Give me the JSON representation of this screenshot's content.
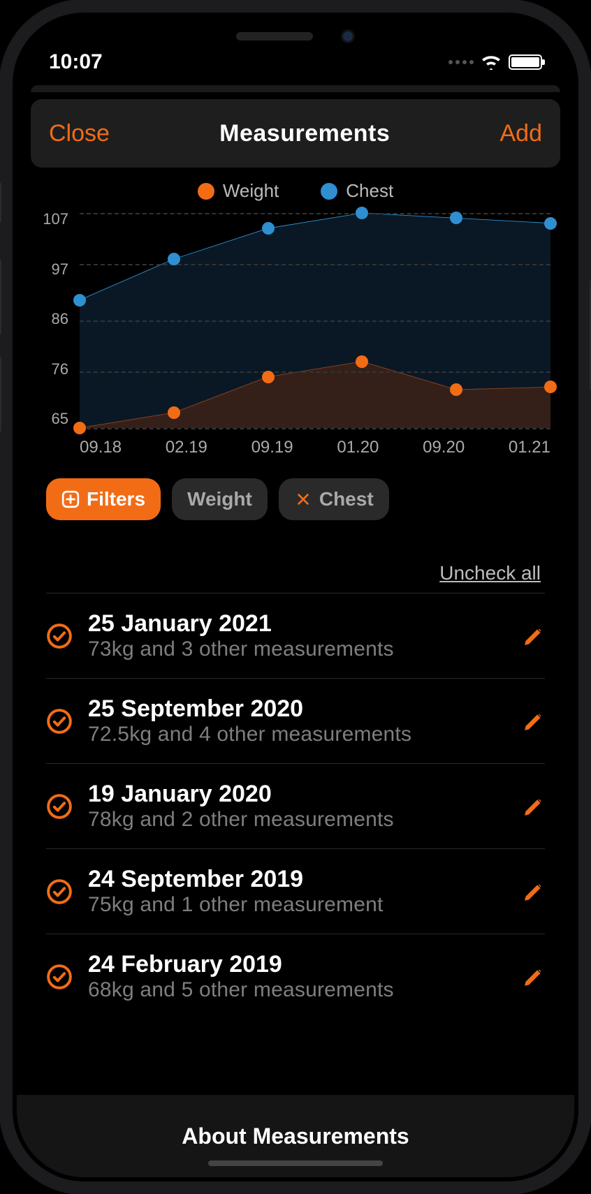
{
  "status": {
    "time": "10:07"
  },
  "nav": {
    "close": "Close",
    "title": "Measurements",
    "add": "Add"
  },
  "legend": {
    "weight": "Weight",
    "chest": "Chest"
  },
  "chart_data": {
    "type": "line",
    "x_labels": [
      "09.18",
      "02.19",
      "09.19",
      "01.20",
      "09.20",
      "01.21"
    ],
    "ylim": [
      65,
      107
    ],
    "y_ticks": [
      107,
      97,
      86,
      76,
      65
    ],
    "series": [
      {
        "name": "Weight",
        "color": "#f26c16",
        "values": [
          65,
          68,
          75,
          78,
          72.5,
          73
        ]
      },
      {
        "name": "Chest",
        "color": "#2f8fd0",
        "values": [
          90,
          98,
          104,
          107,
          106,
          105
        ]
      }
    ]
  },
  "chips": {
    "filters": "Filters",
    "weight": "Weight",
    "chest": "Chest"
  },
  "uncheck": "Uncheck all",
  "entries": [
    {
      "date": "25 January 2021",
      "sub": "73kg and 3 other measurements"
    },
    {
      "date": "25 September 2020",
      "sub": "72.5kg and 4 other measurements"
    },
    {
      "date": "19 January 2020",
      "sub": "78kg and 2 other measurements"
    },
    {
      "date": "24 September 2019",
      "sub": "75kg and 1 other measurement"
    },
    {
      "date": "24 February 2019",
      "sub": "68kg and 5 other measurements"
    }
  ],
  "about": "About Measurements"
}
